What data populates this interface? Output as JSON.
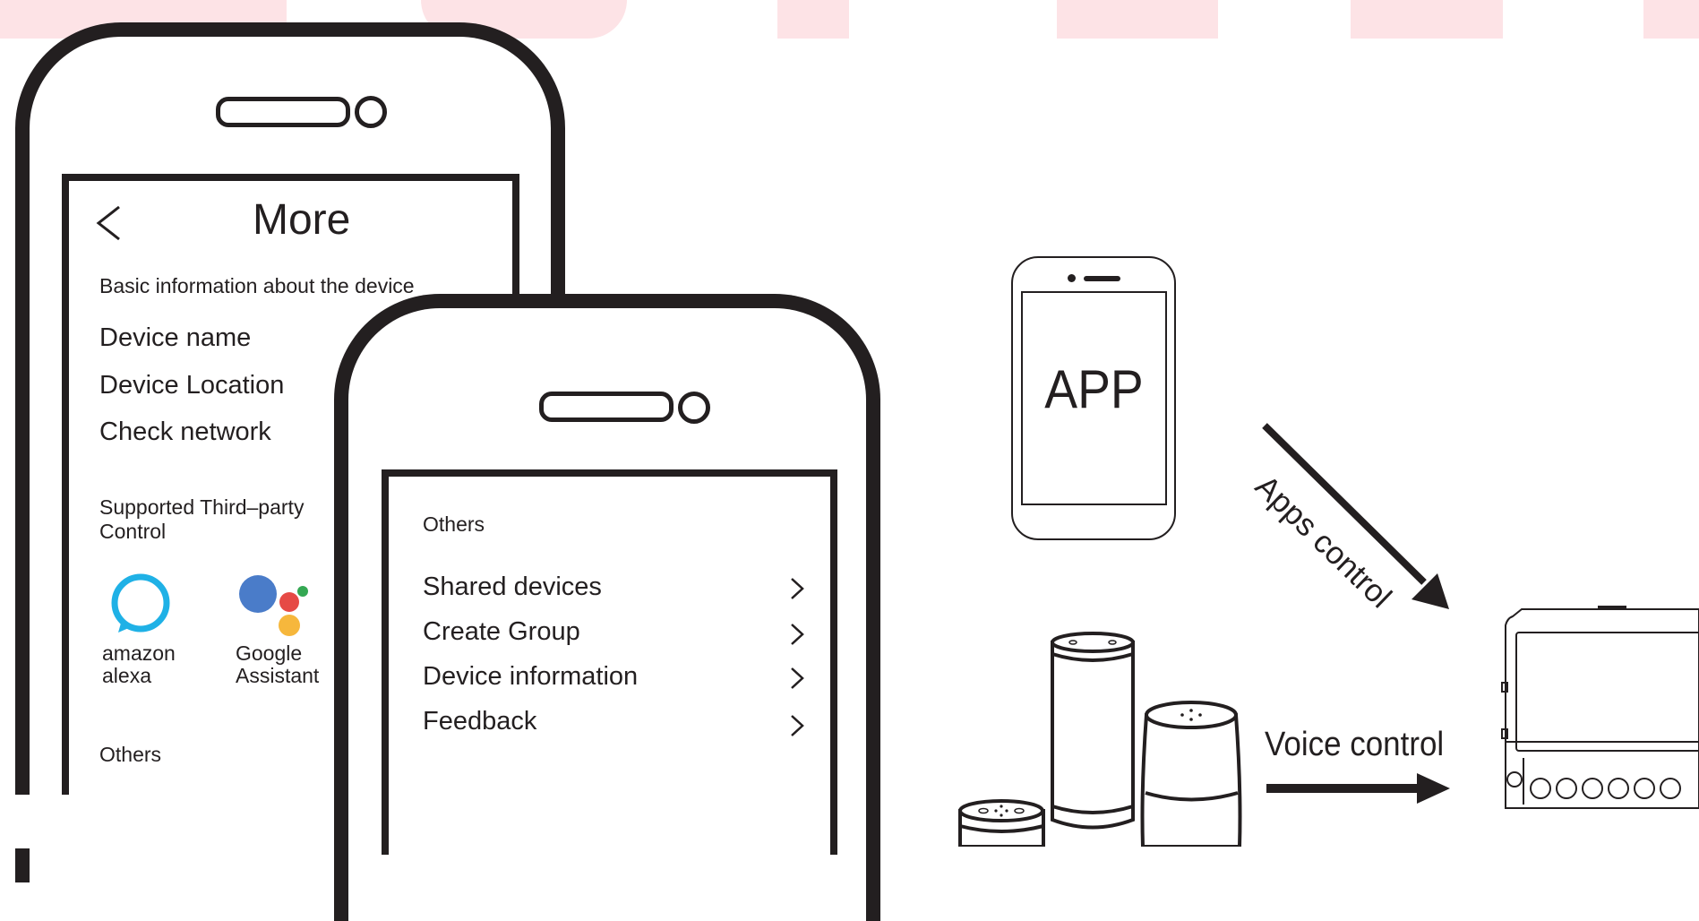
{
  "phone_left": {
    "title": "More",
    "section_basic": "Basic information about the device",
    "items": [
      "Device name",
      "Device Location",
      "Check network"
    ],
    "section_third_party_line1": "Supported Third–party",
    "section_third_party_line2": "Control",
    "alexa_line1": "amazon",
    "alexa_line2": "alexa",
    "google_line1": "Google",
    "google_line2": "Assistant",
    "section_others": "Others"
  },
  "phone_right": {
    "section_others": "Others",
    "items": [
      "Shared devices",
      "Create Group",
      "Device information",
      "Feedback"
    ]
  },
  "app_label": "APP",
  "apps_control_label": "Apps control",
  "voice_control_label": "Voice control",
  "colors": {
    "ink": "#231f20",
    "background_band": "#fde3e6",
    "alexa": "#1fb1e6",
    "google_blue": "#4a7cc9",
    "google_red": "#e64a45",
    "google_yellow": "#f6b73c",
    "google_green": "#34a853"
  }
}
